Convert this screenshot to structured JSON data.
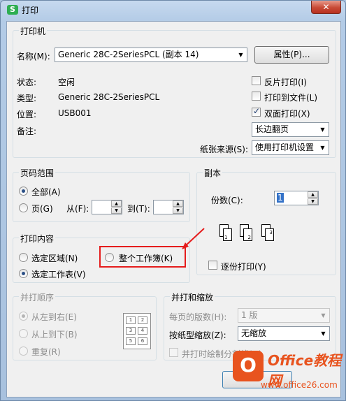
{
  "window": {
    "title": "打印",
    "app_icon": "S",
    "close": "✕"
  },
  "printer": {
    "group_title": "打印机",
    "name_label": "名称(M):",
    "name_value": "Generic 28C-2SeriesPCL (副本 14)",
    "properties_button": "属性(P)...",
    "status_label": "状态:",
    "status_value": "空闲",
    "type_label": "类型:",
    "type_value": "Generic 28C-2SeriesPCL",
    "location_label": "位置:",
    "location_value": "USB001",
    "comment_label": "备注:",
    "reverse_print": {
      "label": "反片打印(I)",
      "checked": false
    },
    "print_to_file": {
      "label": "打印到文件(L)",
      "checked": false
    },
    "duplex": {
      "label": "双面打印(X)",
      "checked": true
    },
    "flip_value": "长边翻页",
    "paper_source_label": "纸张来源(S):",
    "paper_source_value": "使用打印机设置"
  },
  "page_range": {
    "group_title": "页码范围",
    "all_label": "全部(A)",
    "pages_label": "页(G)",
    "from_label": "从(F):",
    "to_label": "到(T):"
  },
  "copies": {
    "group_title": "副本",
    "count_label": "份数(C):",
    "count_value": "1",
    "collate_label": "逐份打印(Y)",
    "pages": [
      "1",
      "2",
      "3"
    ]
  },
  "print_content": {
    "group_title": "打印内容",
    "selection_label": "选定区域(N)",
    "whole_workbook_label": "整个工作簿(K)",
    "selected_sheets_label": "选定工作表(V)"
  },
  "print_order": {
    "group_title": "并打顺序",
    "left_to_right": "从左到右(E)",
    "top_to_bottom": "从上到下(B)",
    "repeat": "重复(R)",
    "grid_numbers": [
      "1",
      "2",
      "3",
      "4",
      "5",
      "6"
    ]
  },
  "combine_scale": {
    "group_title": "并打和缩放",
    "pages_per_sheet_label": "每页的版数(H):",
    "pages_per_sheet_value": "1 版",
    "scale_to_paper_label": "按纸型缩放(Z):",
    "scale_to_paper_value": "无缩放",
    "draw_borders_label": "并打时绘制分割线(D)"
  },
  "watermark": {
    "logo": "O",
    "brand": "Office教程网",
    "site": "www.office26.com"
  },
  "colors": {
    "highlight": "#e51c1c",
    "brand": "#e8531e"
  }
}
